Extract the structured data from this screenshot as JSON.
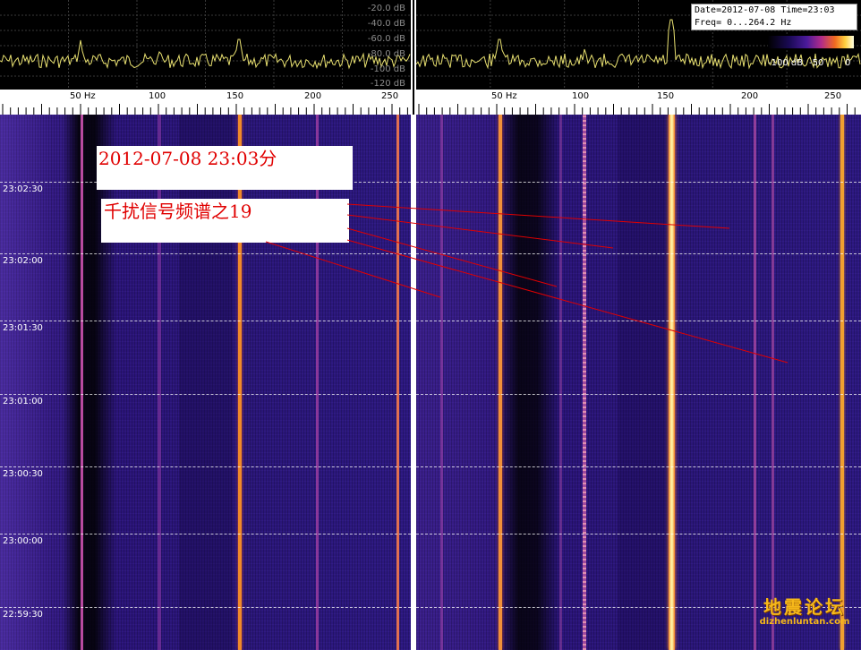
{
  "left_panel": {
    "db_labels": [
      "-20.0 dB",
      "-40.0 dB",
      "-60.0 dB",
      "-80.0 dB",
      "-100 dB",
      "-120 dB"
    ],
    "freq_ticks": [
      {
        "value": 50,
        "label": "50 Hz"
      },
      {
        "value": 100,
        "label": "100"
      },
      {
        "value": 150,
        "label": "150"
      },
      {
        "value": 200,
        "label": "200"
      },
      {
        "value": 250,
        "label": "250"
      }
    ],
    "time_labels": [
      "23:02:30",
      "23:02:00",
      "23:01:30",
      "23:01:00",
      "23:00:30",
      "23:00:00",
      "22:59:30"
    ]
  },
  "right_panel": {
    "freq_ticks": [
      {
        "value": 50,
        "label": "50 Hz"
      },
      {
        "value": 100,
        "label": "100"
      },
      {
        "value": 150,
        "label": "150"
      },
      {
        "value": 200,
        "label": "200"
      },
      {
        "value": 250,
        "label": "250"
      }
    ],
    "info": {
      "line1": "Date=2012-07-08 Time=23:03",
      "line2": "Freq= 0...264.2 Hz"
    },
    "colorbar": {
      "labels": [
        "-100 dB",
        "-50",
        "0"
      ],
      "colors": [
        "#000000",
        "#1a0a55",
        "#4a1a9a",
        "#b02b8a",
        "#f06a20",
        "#ffd040",
        "#ffffe0"
      ]
    }
  },
  "annotations": {
    "date_text": "2012-07-08  23:03分",
    "title_text": "千扰信号频谱之19",
    "text_color": "#e00000",
    "arrow_color": "#e00000"
  },
  "watermark": {
    "name": "地震论坛",
    "url": "dizhenluntan.com"
  },
  "colors": {
    "waterfall_bg": "#24106e",
    "spectrum_trace": "#e8e070",
    "grid_dash": "#ffffff"
  }
}
